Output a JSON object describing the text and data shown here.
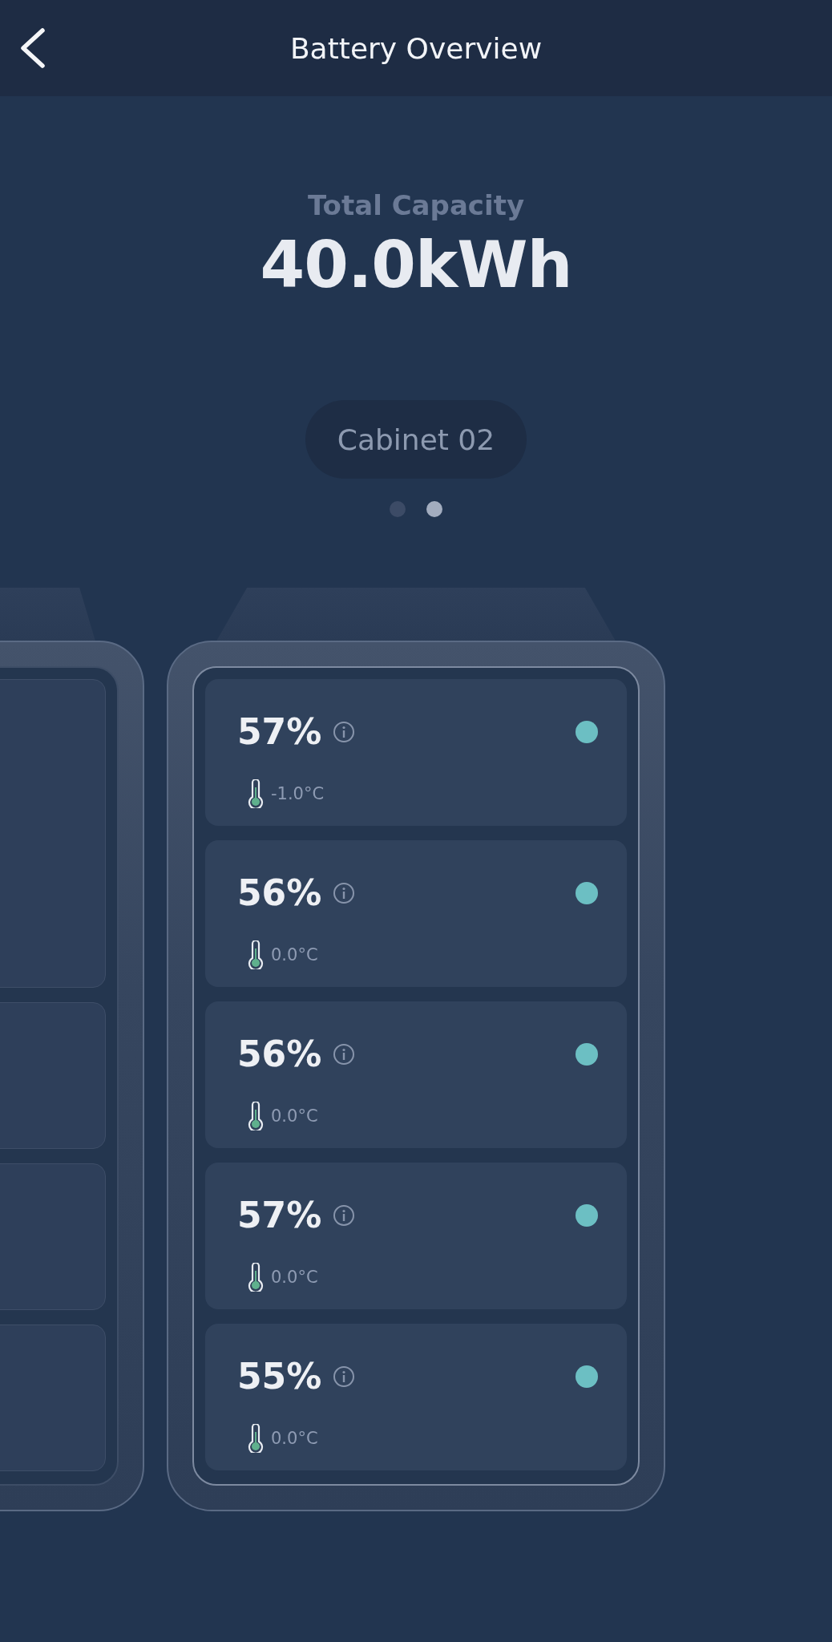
{
  "header": {
    "title": "Battery Overview"
  },
  "summary": {
    "label": "Total Capacity",
    "value": "40.0kWh"
  },
  "cabinet_selector": {
    "label": "Cabinet 02"
  },
  "pager": [
    {
      "selected": false
    },
    {
      "selected": true
    }
  ],
  "modules": [
    {
      "percent": "57%",
      "temperature": "-1.0°C",
      "color": "#6cbfc3"
    },
    {
      "percent": "56%",
      "temperature": "0.0°C",
      "color": "#6cbfc3"
    },
    {
      "percent": "56%",
      "temperature": "0.0°C",
      "color": "#6cbfc3"
    },
    {
      "percent": "57%",
      "temperature": "0.0°C",
      "color": "#6cbfc3"
    },
    {
      "percent": "55%",
      "temperature": "0.0°C",
      "color": "#6cbfc3"
    }
  ]
}
